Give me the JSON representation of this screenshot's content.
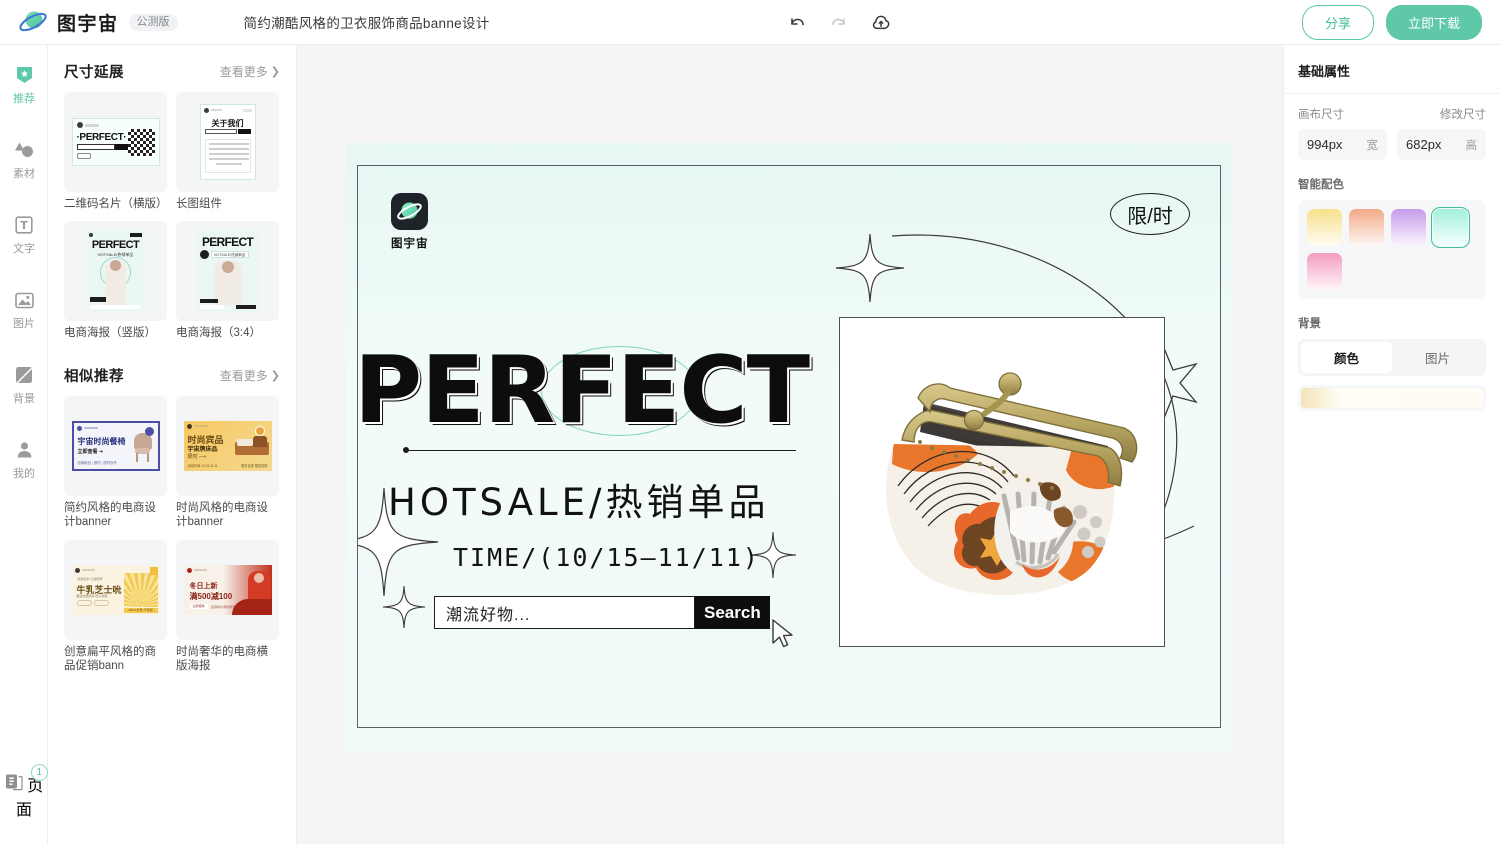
{
  "topbar": {
    "brand": "图宇宙",
    "beta_tag": "公测版",
    "doc_title": "简约潮酷风格的卫衣服饰商品banne设计",
    "icons": [
      {
        "name": "undo-icon",
        "label": "撤销"
      },
      {
        "name": "redo-icon",
        "label": "重做"
      },
      {
        "name": "cloud-upload-icon",
        "label": "上传"
      }
    ],
    "share_label": "分享",
    "download_label": "立即下载",
    "accent_color": "#5ec8a8"
  },
  "rail": {
    "items": [
      {
        "label": "推荐",
        "icon": "star-badge-icon",
        "active": true
      },
      {
        "label": "素材",
        "icon": "shapes-icon",
        "active": false
      },
      {
        "label": "文字",
        "icon": "text-box-icon",
        "active": false
      },
      {
        "label": "图片",
        "icon": "image-icon",
        "active": false
      },
      {
        "label": "背景",
        "icon": "background-icon",
        "active": false
      },
      {
        "label": "我的",
        "icon": "user-icon",
        "active": false
      }
    ],
    "pages": {
      "label": "页面",
      "icon": "pages-icon",
      "badge": "1"
    }
  },
  "panel": {
    "sections": [
      {
        "title": "尺寸延展",
        "more_label": "查看更多",
        "items": [
          {
            "label": "二维码名片（横版）",
            "art": "qrcard"
          },
          {
            "label": "长图组件",
            "art": "longimg"
          },
          {
            "label": "电商海报（竖版）",
            "art": "poster1"
          },
          {
            "label": "电商海报（3:4）",
            "art": "poster2"
          }
        ]
      },
      {
        "title": "相似推荐",
        "more_label": "查看更多",
        "items": [
          {
            "label": "简约风格的电商设计banner",
            "art": "chairban"
          },
          {
            "label": "时尚风格的电商设计banner",
            "art": "bedban"
          },
          {
            "label": "创意扁平风格的商品促销bann",
            "art": "cakeban"
          },
          {
            "label": "时尚奢华的电商横版海报",
            "art": "redban"
          }
        ]
      }
    ]
  },
  "canvas": {
    "logo_text": "图宇宙",
    "headline": "PERFECT",
    "subheadline": "HOTSALE/热销单品",
    "time_text": "TIME/(10/15—11/11)",
    "search_value": "潮流好物...",
    "search_button": "Search",
    "badge_text": "限/时",
    "product_alt": "retro-floral-coin-purse",
    "background_color": "#eef9f6"
  },
  "props": {
    "title": "基础属性",
    "canvas_size_label": "画布尺寸",
    "modify_size_label": "修改尺寸",
    "width_value": "994px",
    "width_unit": "宽",
    "height_value": "682px",
    "height_unit": "高",
    "smart_palette_label": "智能配色",
    "swatches": [
      {
        "name": "yellow",
        "from": "#f7e08a",
        "to": "#fffdf3",
        "selected": false
      },
      {
        "name": "orange",
        "from": "#f2a987",
        "to": "#fef8f5",
        "selected": false
      },
      {
        "name": "purple",
        "from": "#c79bea",
        "to": "#faf6fe",
        "selected": false
      },
      {
        "name": "mint",
        "from": "#a4f0dd",
        "to": "#f6fffd",
        "selected": true
      },
      {
        "name": "pink",
        "from": "#f49cc0",
        "to": "#fff6fa",
        "selected": false
      }
    ],
    "background_label": "背景",
    "tabs": [
      {
        "label": "颜色",
        "active": true
      },
      {
        "label": "图片",
        "active": false
      }
    ],
    "bg_fill_from": "#f3e3b8",
    "bg_fill_to": "#fffdf6"
  }
}
